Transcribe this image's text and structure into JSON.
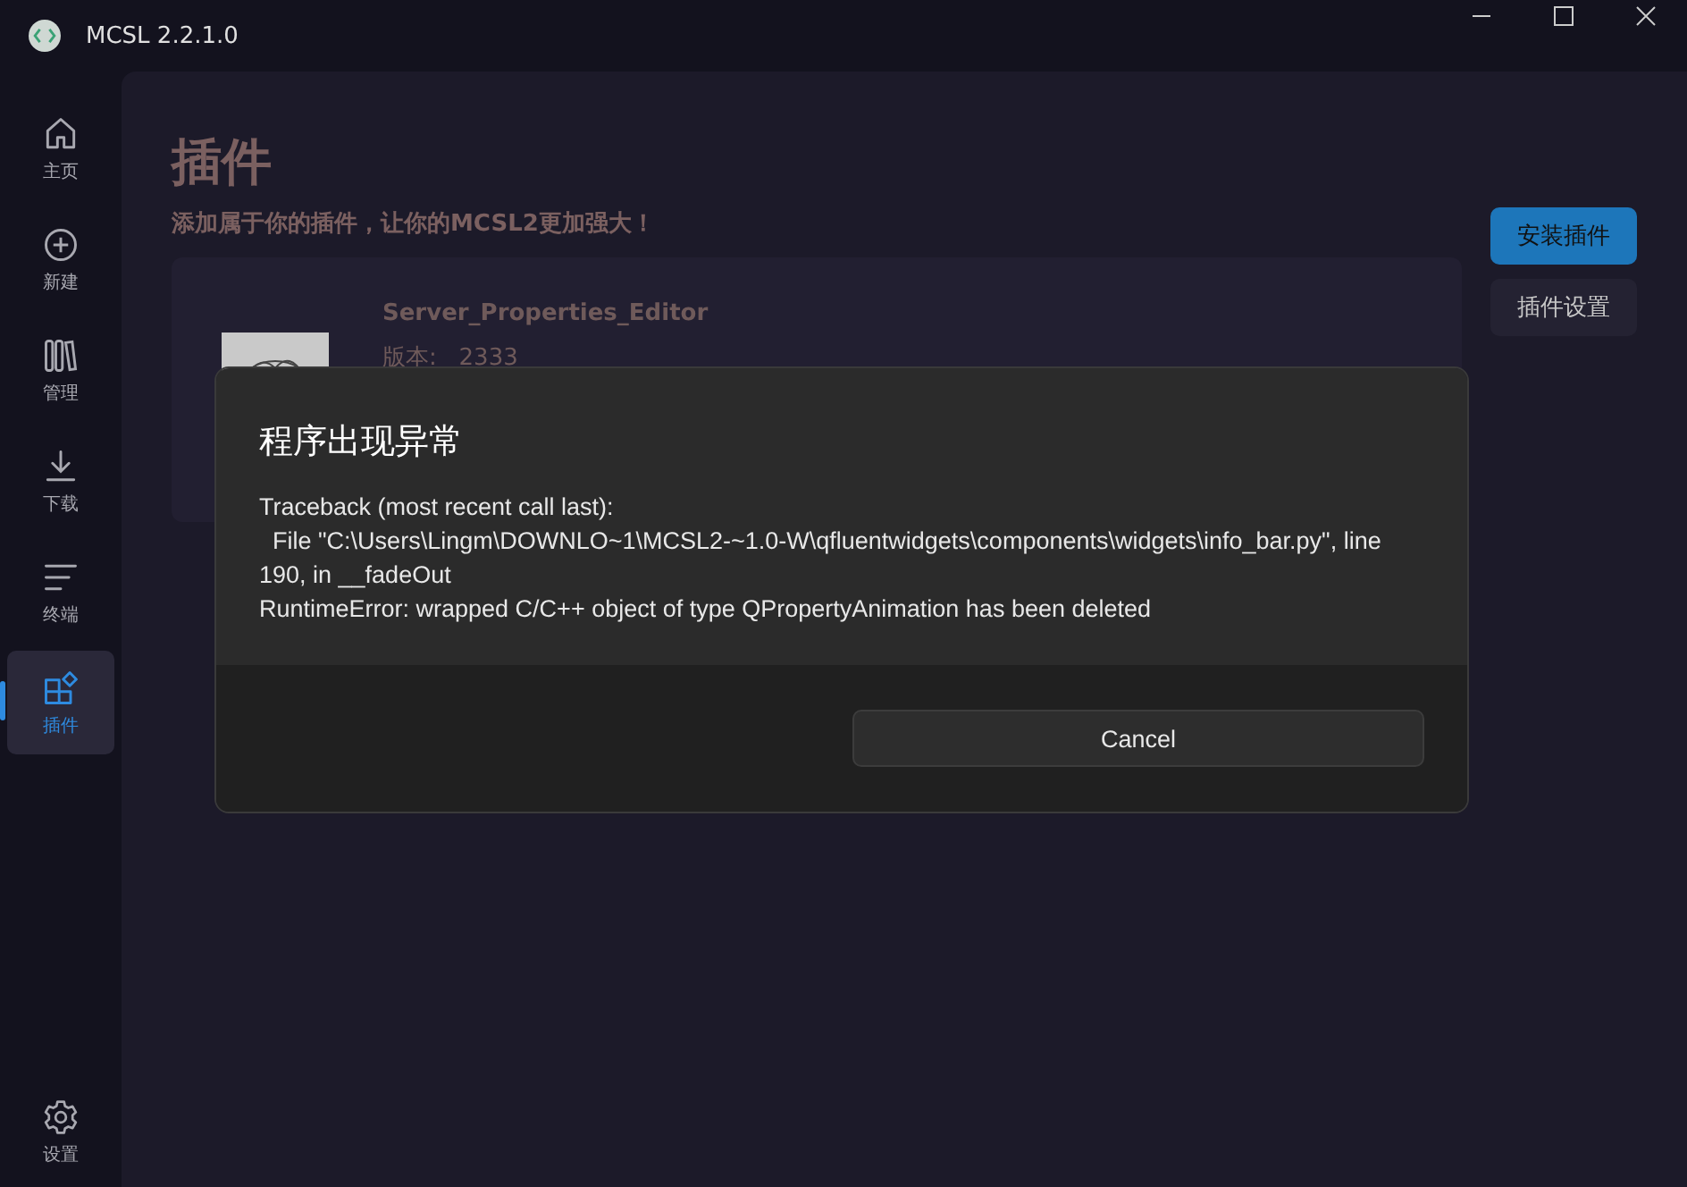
{
  "window": {
    "title": "MCSL 2.2.1.0"
  },
  "nav": [
    {
      "label": "主页",
      "selected": false
    },
    {
      "label": "新建",
      "selected": false
    },
    {
      "label": "管理",
      "selected": false
    },
    {
      "label": "下载",
      "selected": false
    },
    {
      "label": "终端",
      "selected": false
    },
    {
      "label": "插件",
      "selected": true
    }
  ],
  "nav_bottom": {
    "label": "设置"
  },
  "page": {
    "title": "插件",
    "subtitle": "添加属于你的插件，让你的MCSL2更加强大！",
    "buttons": [
      {
        "label": "安装插件",
        "kind": "primary"
      },
      {
        "label": "插件设置",
        "kind": "secondary"
      }
    ],
    "plugins": [
      {
        "name": "Server_Properties_Editor",
        "version": "版本:   2333"
      }
    ]
  },
  "dialog": {
    "title": "程序出现异常",
    "lines": [
      "Traceback (most recent call last):",
      "  File \"C:\\Users\\Lingm\\DOWNLO~1\\MCSL2-~1.0-W\\qfluentwidgets\\components\\widgets\\info_bar.py\", line 190, in __fadeOut",
      "RuntimeError: wrapped C/C++ object of type QPropertyAnimation has been deleted"
    ],
    "button": "Cancel"
  }
}
